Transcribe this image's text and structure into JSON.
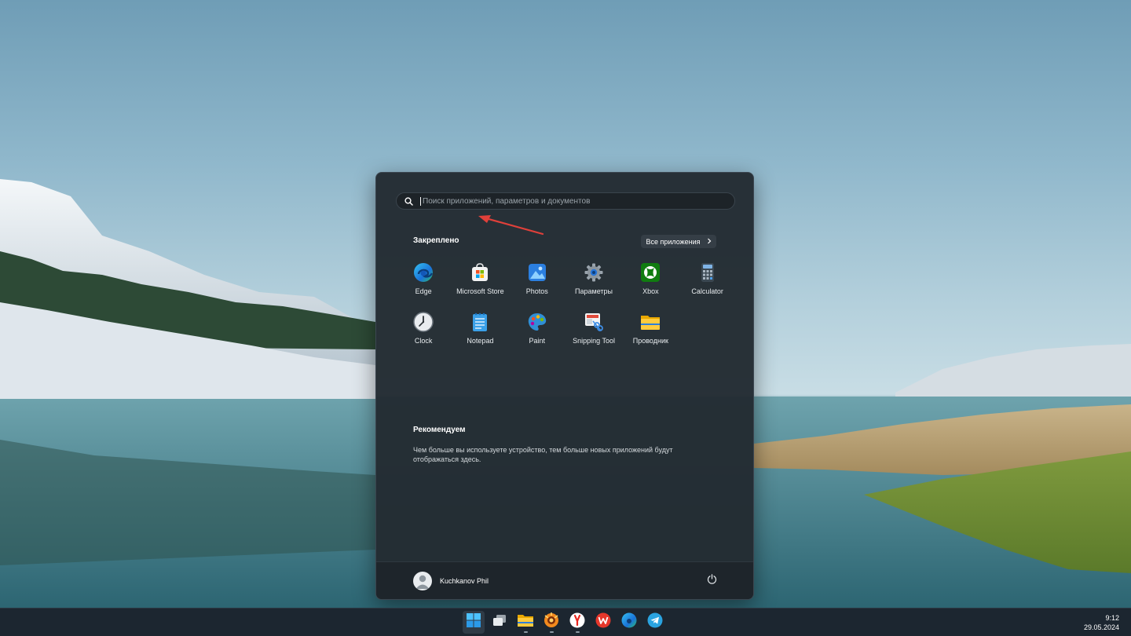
{
  "search": {
    "placeholder": "Поиск приложений, параметров и документов"
  },
  "pinned": {
    "title": "Закреплено",
    "all_apps_label": "Все приложения",
    "apps": [
      {
        "label": "Edge",
        "icon": "edge-icon"
      },
      {
        "label": "Microsoft Store",
        "icon": "microsoft-store-icon"
      },
      {
        "label": "Photos",
        "icon": "photos-icon"
      },
      {
        "label": "Параметры",
        "icon": "settings-gear-icon"
      },
      {
        "label": "Xbox",
        "icon": "xbox-icon"
      },
      {
        "label": "Calculator",
        "icon": "calculator-icon"
      },
      {
        "label": "Clock",
        "icon": "clock-icon"
      },
      {
        "label": "Notepad",
        "icon": "notepad-icon"
      },
      {
        "label": "Paint",
        "icon": "paint-palette-icon"
      },
      {
        "label": "Snipping Tool",
        "icon": "snipping-tool-icon"
      },
      {
        "label": "Проводник",
        "icon": "file-explorer-folder-icon"
      }
    ]
  },
  "recommended": {
    "title": "Рекомендуем",
    "text": "Чем больше вы используете устройство, тем больше новых приложений будут отображаться здесь."
  },
  "user": {
    "name": "Kuchkanov Phil"
  },
  "taskbar": {
    "items": [
      "start-icon",
      "task-view-icon",
      "file-explorer-icon",
      "photo-app-icon",
      "yandex-browser-icon",
      "wps-office-icon",
      "edge-icon",
      "telegram-icon"
    ],
    "time": "9:12",
    "date": "29.05.2024"
  },
  "colors": {
    "menu_bg": "#232b32",
    "accent": "#8ab8ff",
    "annotation_arrow": "#e0403a"
  }
}
